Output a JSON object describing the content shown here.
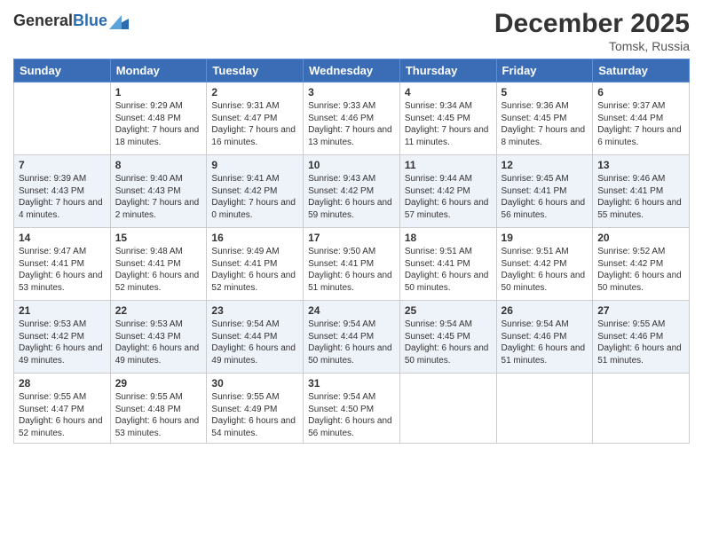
{
  "header": {
    "logo_general": "General",
    "logo_blue": "Blue",
    "title": "December 2025",
    "subtitle": "Tomsk, Russia"
  },
  "weekdays": [
    "Sunday",
    "Monday",
    "Tuesday",
    "Wednesday",
    "Thursday",
    "Friday",
    "Saturday"
  ],
  "rows": [
    [
      {
        "day": "",
        "sunrise": "",
        "sunset": "",
        "daylight": ""
      },
      {
        "day": "1",
        "sunrise": "Sunrise: 9:29 AM",
        "sunset": "Sunset: 4:48 PM",
        "daylight": "Daylight: 7 hours and 18 minutes."
      },
      {
        "day": "2",
        "sunrise": "Sunrise: 9:31 AM",
        "sunset": "Sunset: 4:47 PM",
        "daylight": "Daylight: 7 hours and 16 minutes."
      },
      {
        "day": "3",
        "sunrise": "Sunrise: 9:33 AM",
        "sunset": "Sunset: 4:46 PM",
        "daylight": "Daylight: 7 hours and 13 minutes."
      },
      {
        "day": "4",
        "sunrise": "Sunrise: 9:34 AM",
        "sunset": "Sunset: 4:45 PM",
        "daylight": "Daylight: 7 hours and 11 minutes."
      },
      {
        "day": "5",
        "sunrise": "Sunrise: 9:36 AM",
        "sunset": "Sunset: 4:45 PM",
        "daylight": "Daylight: 7 hours and 8 minutes."
      },
      {
        "day": "6",
        "sunrise": "Sunrise: 9:37 AM",
        "sunset": "Sunset: 4:44 PM",
        "daylight": "Daylight: 7 hours and 6 minutes."
      }
    ],
    [
      {
        "day": "7",
        "sunrise": "Sunrise: 9:39 AM",
        "sunset": "Sunset: 4:43 PM",
        "daylight": "Daylight: 7 hours and 4 minutes."
      },
      {
        "day": "8",
        "sunrise": "Sunrise: 9:40 AM",
        "sunset": "Sunset: 4:43 PM",
        "daylight": "Daylight: 7 hours and 2 minutes."
      },
      {
        "day": "9",
        "sunrise": "Sunrise: 9:41 AM",
        "sunset": "Sunset: 4:42 PM",
        "daylight": "Daylight: 7 hours and 0 minutes."
      },
      {
        "day": "10",
        "sunrise": "Sunrise: 9:43 AM",
        "sunset": "Sunset: 4:42 PM",
        "daylight": "Daylight: 6 hours and 59 minutes."
      },
      {
        "day": "11",
        "sunrise": "Sunrise: 9:44 AM",
        "sunset": "Sunset: 4:42 PM",
        "daylight": "Daylight: 6 hours and 57 minutes."
      },
      {
        "day": "12",
        "sunrise": "Sunrise: 9:45 AM",
        "sunset": "Sunset: 4:41 PM",
        "daylight": "Daylight: 6 hours and 56 minutes."
      },
      {
        "day": "13",
        "sunrise": "Sunrise: 9:46 AM",
        "sunset": "Sunset: 4:41 PM",
        "daylight": "Daylight: 6 hours and 55 minutes."
      }
    ],
    [
      {
        "day": "14",
        "sunrise": "Sunrise: 9:47 AM",
        "sunset": "Sunset: 4:41 PM",
        "daylight": "Daylight: 6 hours and 53 minutes."
      },
      {
        "day": "15",
        "sunrise": "Sunrise: 9:48 AM",
        "sunset": "Sunset: 4:41 PM",
        "daylight": "Daylight: 6 hours and 52 minutes."
      },
      {
        "day": "16",
        "sunrise": "Sunrise: 9:49 AM",
        "sunset": "Sunset: 4:41 PM",
        "daylight": "Daylight: 6 hours and 52 minutes."
      },
      {
        "day": "17",
        "sunrise": "Sunrise: 9:50 AM",
        "sunset": "Sunset: 4:41 PM",
        "daylight": "Daylight: 6 hours and 51 minutes."
      },
      {
        "day": "18",
        "sunrise": "Sunrise: 9:51 AM",
        "sunset": "Sunset: 4:41 PM",
        "daylight": "Daylight: 6 hours and 50 minutes."
      },
      {
        "day": "19",
        "sunrise": "Sunrise: 9:51 AM",
        "sunset": "Sunset: 4:42 PM",
        "daylight": "Daylight: 6 hours and 50 minutes."
      },
      {
        "day": "20",
        "sunrise": "Sunrise: 9:52 AM",
        "sunset": "Sunset: 4:42 PM",
        "daylight": "Daylight: 6 hours and 50 minutes."
      }
    ],
    [
      {
        "day": "21",
        "sunrise": "Sunrise: 9:53 AM",
        "sunset": "Sunset: 4:42 PM",
        "daylight": "Daylight: 6 hours and 49 minutes."
      },
      {
        "day": "22",
        "sunrise": "Sunrise: 9:53 AM",
        "sunset": "Sunset: 4:43 PM",
        "daylight": "Daylight: 6 hours and 49 minutes."
      },
      {
        "day": "23",
        "sunrise": "Sunrise: 9:54 AM",
        "sunset": "Sunset: 4:44 PM",
        "daylight": "Daylight: 6 hours and 49 minutes."
      },
      {
        "day": "24",
        "sunrise": "Sunrise: 9:54 AM",
        "sunset": "Sunset: 4:44 PM",
        "daylight": "Daylight: 6 hours and 50 minutes."
      },
      {
        "day": "25",
        "sunrise": "Sunrise: 9:54 AM",
        "sunset": "Sunset: 4:45 PM",
        "daylight": "Daylight: 6 hours and 50 minutes."
      },
      {
        "day": "26",
        "sunrise": "Sunrise: 9:54 AM",
        "sunset": "Sunset: 4:46 PM",
        "daylight": "Daylight: 6 hours and 51 minutes."
      },
      {
        "day": "27",
        "sunrise": "Sunrise: 9:55 AM",
        "sunset": "Sunset: 4:46 PM",
        "daylight": "Daylight: 6 hours and 51 minutes."
      }
    ],
    [
      {
        "day": "28",
        "sunrise": "Sunrise: 9:55 AM",
        "sunset": "Sunset: 4:47 PM",
        "daylight": "Daylight: 6 hours and 52 minutes."
      },
      {
        "day": "29",
        "sunrise": "Sunrise: 9:55 AM",
        "sunset": "Sunset: 4:48 PM",
        "daylight": "Daylight: 6 hours and 53 minutes."
      },
      {
        "day": "30",
        "sunrise": "Sunrise: 9:55 AM",
        "sunset": "Sunset: 4:49 PM",
        "daylight": "Daylight: 6 hours and 54 minutes."
      },
      {
        "day": "31",
        "sunrise": "Sunrise: 9:54 AM",
        "sunset": "Sunset: 4:50 PM",
        "daylight": "Daylight: 6 hours and 56 minutes."
      },
      {
        "day": "",
        "sunrise": "",
        "sunset": "",
        "daylight": ""
      },
      {
        "day": "",
        "sunrise": "",
        "sunset": "",
        "daylight": ""
      },
      {
        "day": "",
        "sunrise": "",
        "sunset": "",
        "daylight": ""
      }
    ]
  ]
}
